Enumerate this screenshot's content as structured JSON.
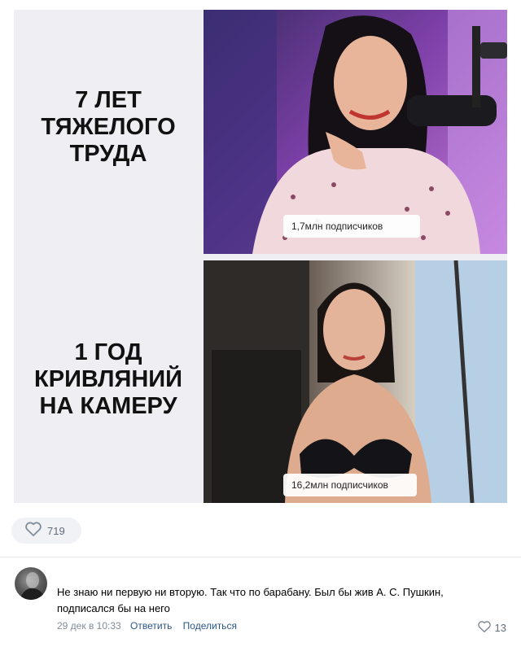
{
  "meme": {
    "top_caption": [
      "7 ЛЕТ",
      "ТЯЖЕЛОГО",
      "ТРУДА"
    ],
    "bottom_caption": [
      "1 ГОД",
      "КРИВЛЯНИЙ",
      "НА КАМЕРУ"
    ],
    "top_subscribers": "1,7млн подписчиков",
    "bottom_subscribers": "16,2млн подписчиков"
  },
  "post": {
    "likes": "719",
    "like_icon": "heart-outline-icon"
  },
  "comment": {
    "text": "Не знаю ни первую ни вторую. Так что по барабану. Был бы жив А. С. Пушкин, подписался бы на него",
    "date": "29 дек в 10:33",
    "reply_label": "Ответить",
    "share_label": "Поделиться",
    "likes": "13"
  },
  "colors": {
    "link": "#2a5885",
    "meta": "#818c99",
    "icon": "#818c99",
    "like_bg": "#f0f2f5"
  }
}
